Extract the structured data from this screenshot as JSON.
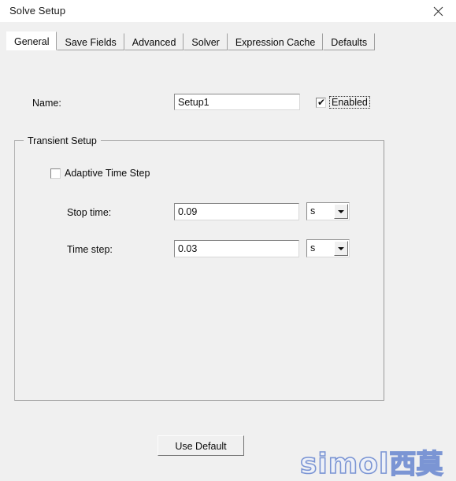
{
  "window": {
    "title": "Solve Setup",
    "close_icon": "close-x-icon"
  },
  "tabs": [
    {
      "label": "General",
      "active": true
    },
    {
      "label": "Save Fields",
      "active": false
    },
    {
      "label": "Advanced",
      "active": false
    },
    {
      "label": "Solver",
      "active": false
    },
    {
      "label": "Expression Cache",
      "active": false
    },
    {
      "label": "Defaults",
      "active": false
    }
  ],
  "general": {
    "name_label": "Name:",
    "name_value": "Setup1",
    "enabled_label": "Enabled",
    "enabled_checked": true,
    "enabled_check_glyph": "✔"
  },
  "transient_setup": {
    "group_title": "Transient Setup",
    "adaptive_label": "Adaptive Time Step",
    "adaptive_checked": false,
    "stop_time": {
      "label": "Stop time:",
      "value": "0.09",
      "unit": "s"
    },
    "time_step": {
      "label": "Time step:",
      "value": "0.03",
      "unit": "s"
    }
  },
  "footer": {
    "use_default_label": "Use Default"
  },
  "watermark": {
    "latin": "simol",
    "cjk": "西莫",
    "color": "#7b95d4"
  },
  "colors": {
    "dialog_bg": "#f0f0f0",
    "titlebar_bg": "#ffffff",
    "field_bg": "#ffffff",
    "text": "#0a0a0a",
    "border": "#a0a0a0"
  }
}
